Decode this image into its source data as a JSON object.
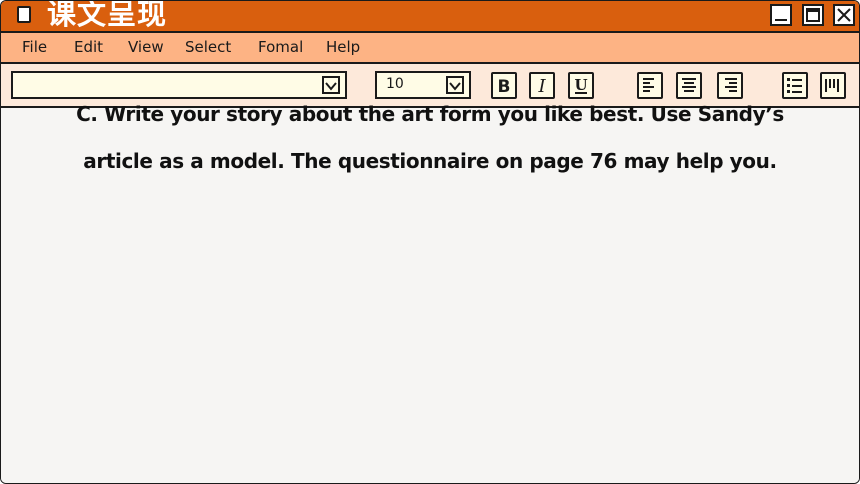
{
  "window": {
    "title": "课文呈现",
    "colors": {
      "titlebar": "#d95f0e",
      "menubar": "#fdb384",
      "toolbar": "#fde9da",
      "page": "#f6f5f3"
    }
  },
  "menu": [
    "File",
    "Edit",
    "View",
    "Select",
    "Fomal",
    "Help"
  ],
  "toolbar": {
    "font_value": "",
    "size_value": "10",
    "bold_label": "B",
    "italic_label": "I",
    "underline_label": "U"
  },
  "content": {
    "lines": [
      "C. Write your story about the art form you like best. Use Sandy’s",
      "article as a model. The questionnaire on page 76 may help you."
    ]
  }
}
